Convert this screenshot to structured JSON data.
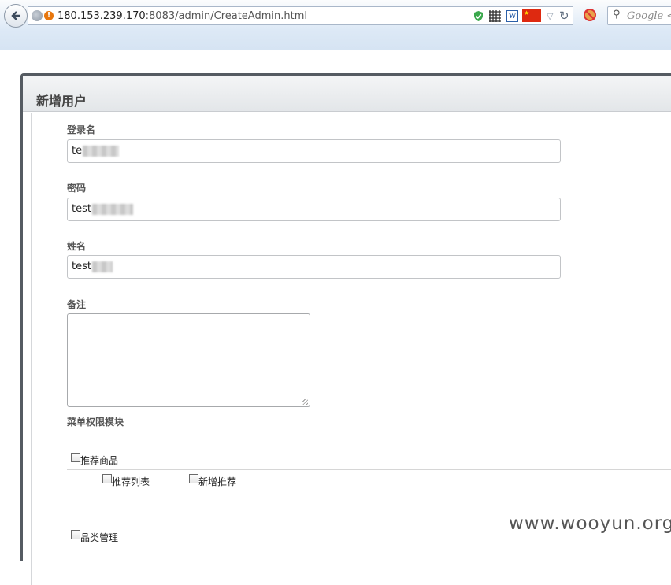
{
  "browser": {
    "url_host": "180.153.239.170",
    "url_rest": ":8083/admin/CreateAdmin.html",
    "search_placeholder": "Google <"
  },
  "panel": {
    "title": "新增用户"
  },
  "form": {
    "login_name": {
      "label": "登录名",
      "value": "te"
    },
    "password": {
      "label": "密码",
      "value": "test"
    },
    "real_name": {
      "label": "姓名",
      "value": "test"
    },
    "remark": {
      "label": "备注",
      "value": ""
    },
    "menu_section_label": "菜单权限模块"
  },
  "menu_permissions": [
    {
      "label": "推荐商品",
      "children": [
        {
          "label": "推荐列表"
        },
        {
          "label": "新增推荐"
        }
      ]
    },
    {
      "label": "品类管理",
      "children": []
    }
  ],
  "watermark": "www.wooyun.org",
  "colors": {
    "warning": "#e8770e",
    "flag": "#de2910"
  }
}
